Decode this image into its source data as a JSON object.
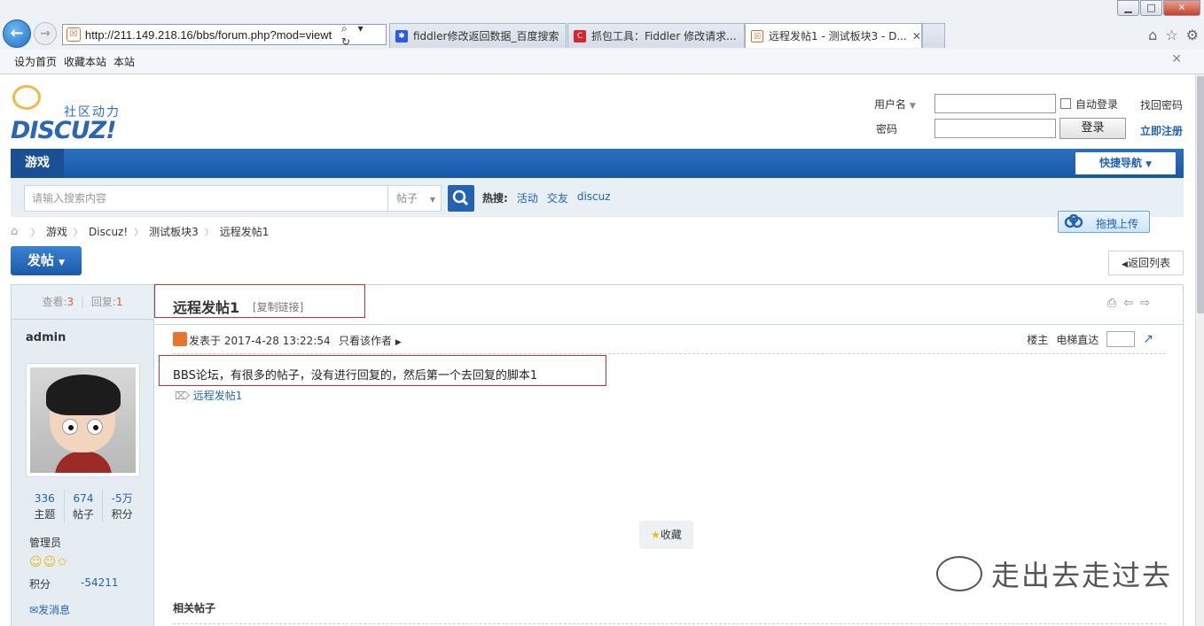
{
  "browser": {
    "window_min": "▁",
    "window_max": "□",
    "window_close": "✕",
    "url": "http://211.149.218.16/bbs/forum.php?mod=viewt",
    "address_tools": "⌕ ▾ ↻",
    "tabs": [
      {
        "label": "fiddler修改返回数据_百度搜索"
      },
      {
        "label": "抓包工具：Fiddler 修改请求..."
      },
      {
        "label": "远程发帖1 - 测试板块3 - D..."
      }
    ],
    "links_bar": [
      "设为首页",
      "收藏本站",
      "本站"
    ]
  },
  "header": {
    "logo_tag": "社区动力",
    "logo_word": "DISCUZ!",
    "login": {
      "username_label": "用户名",
      "password_label": "密码",
      "auto_login": "自动登录",
      "login_button": "登录",
      "find_password": "找回密码",
      "register": "立即注册"
    }
  },
  "nav": {
    "active_item": "游戏",
    "quick_nav": "快捷导航"
  },
  "search": {
    "placeholder": "请输入搜索内容",
    "type": "帖子",
    "hot_label": "热搜:",
    "hot": [
      "活动",
      "交友",
      "discuz"
    ]
  },
  "upload_label": "拖拽上传",
  "breadcrumb": [
    "游戏",
    "Discuz!",
    "测试板块3",
    "远程发帖1"
  ],
  "post_button": "发帖",
  "back_to_list": "返回列表",
  "thread": {
    "views_label": "查看:",
    "views": "3",
    "replies_label": "回复:",
    "replies": "1",
    "title": "远程发帖1",
    "copy_link": "[复制链接]",
    "author": {
      "name": "admin",
      "topics": "336",
      "topics_label": "主题",
      "posts": "674",
      "posts_label": "帖子",
      "credits": "-5万",
      "credits_label": "积分",
      "role": "管理员",
      "stars": "☺☺✩",
      "score_label": "积分",
      "score": "-54211",
      "message": "发消息"
    },
    "post_time": "发表于 2017-4-28 13:22:54",
    "only_author": "只看该作者",
    "floor_owner": "楼主",
    "jump_label": "电梯直达",
    "body": "BBS论坛，有很多的帖子，没有进行回复的，然后第一个去回复的脚本1",
    "tag": "远程发帖1",
    "favorite": "收藏",
    "related": "相关帖子"
  },
  "watermark": "走出去走过去",
  "colors": {
    "brand_blue": "#2463b4",
    "nav_blue": "#1859a6",
    "highlight_red": "#c8322c",
    "count_orange": "#e15a2a"
  }
}
